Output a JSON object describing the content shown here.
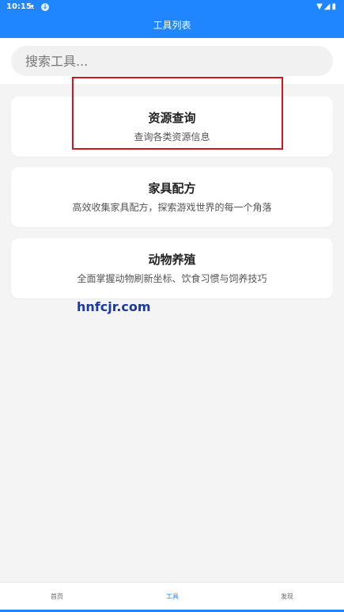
{
  "status": {
    "time": "10:15",
    "notif_icon_1": "cat-icon",
    "notif_icon_2": "download-icon",
    "icons_right": [
      "wifi-icon",
      "signal-icon",
      "battery-icon"
    ]
  },
  "header": {
    "title": "工具列表"
  },
  "search": {
    "placeholder": "搜索工具..."
  },
  "cards": [
    {
      "title": "资源查询",
      "subtitle": "查询各类资源信息"
    },
    {
      "title": "家具配方",
      "subtitle": "高效收集家具配方，探索游戏世界的每一个角落"
    },
    {
      "title": "动物养殖",
      "subtitle": "全面掌握动物刷新坐标、饮食习惯与饲养技巧"
    }
  ],
  "watermark": "hnfcjr.com",
  "bottom_nav": [
    {
      "label": "首页",
      "active": false
    },
    {
      "label": "工具",
      "active": true
    },
    {
      "label": "发现",
      "active": false
    }
  ],
  "colors": {
    "accent": "#1f86ff",
    "highlight_border": "#d4161c"
  }
}
